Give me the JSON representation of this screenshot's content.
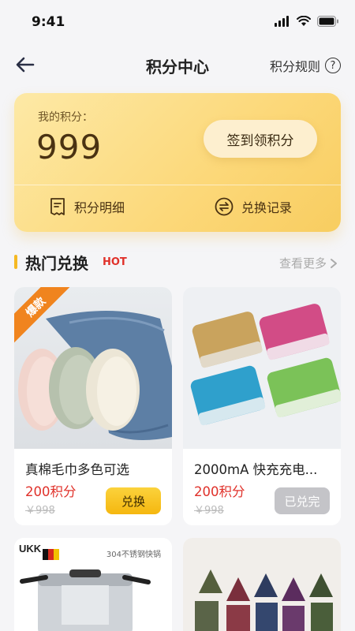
{
  "status": {
    "time": "9:41"
  },
  "nav": {
    "title": "积分中心",
    "rules_label": "积分规则",
    "rules_icon": "?"
  },
  "points_card": {
    "label": "我的积分：",
    "points": "999",
    "signin_label": "签到领积分",
    "detail_label": "积分明细",
    "records_label": "兑换记录"
  },
  "section": {
    "title": "热门兑换",
    "hot_tag": "HOT",
    "more_label": "查看更多"
  },
  "products": [
    {
      "name": "真棉毛巾多色可选",
      "price": "200积分",
      "original_price": "￥998",
      "button": "兑换",
      "badge": "爆款",
      "status": "available"
    },
    {
      "name": "2000mA 快充充电...",
      "price": "200积分",
      "original_price": "￥998",
      "button": "已兑完",
      "status": "sold-out"
    }
  ],
  "products_row2": [
    {
      "brand_text": "UKK",
      "desc_text": "304不锈钢快锅"
    },
    {}
  ],
  "colors": {
    "accent": "#f5b923",
    "price": "#e0312a",
    "hot": "#e0312a",
    "badge": "#f0841e"
  }
}
